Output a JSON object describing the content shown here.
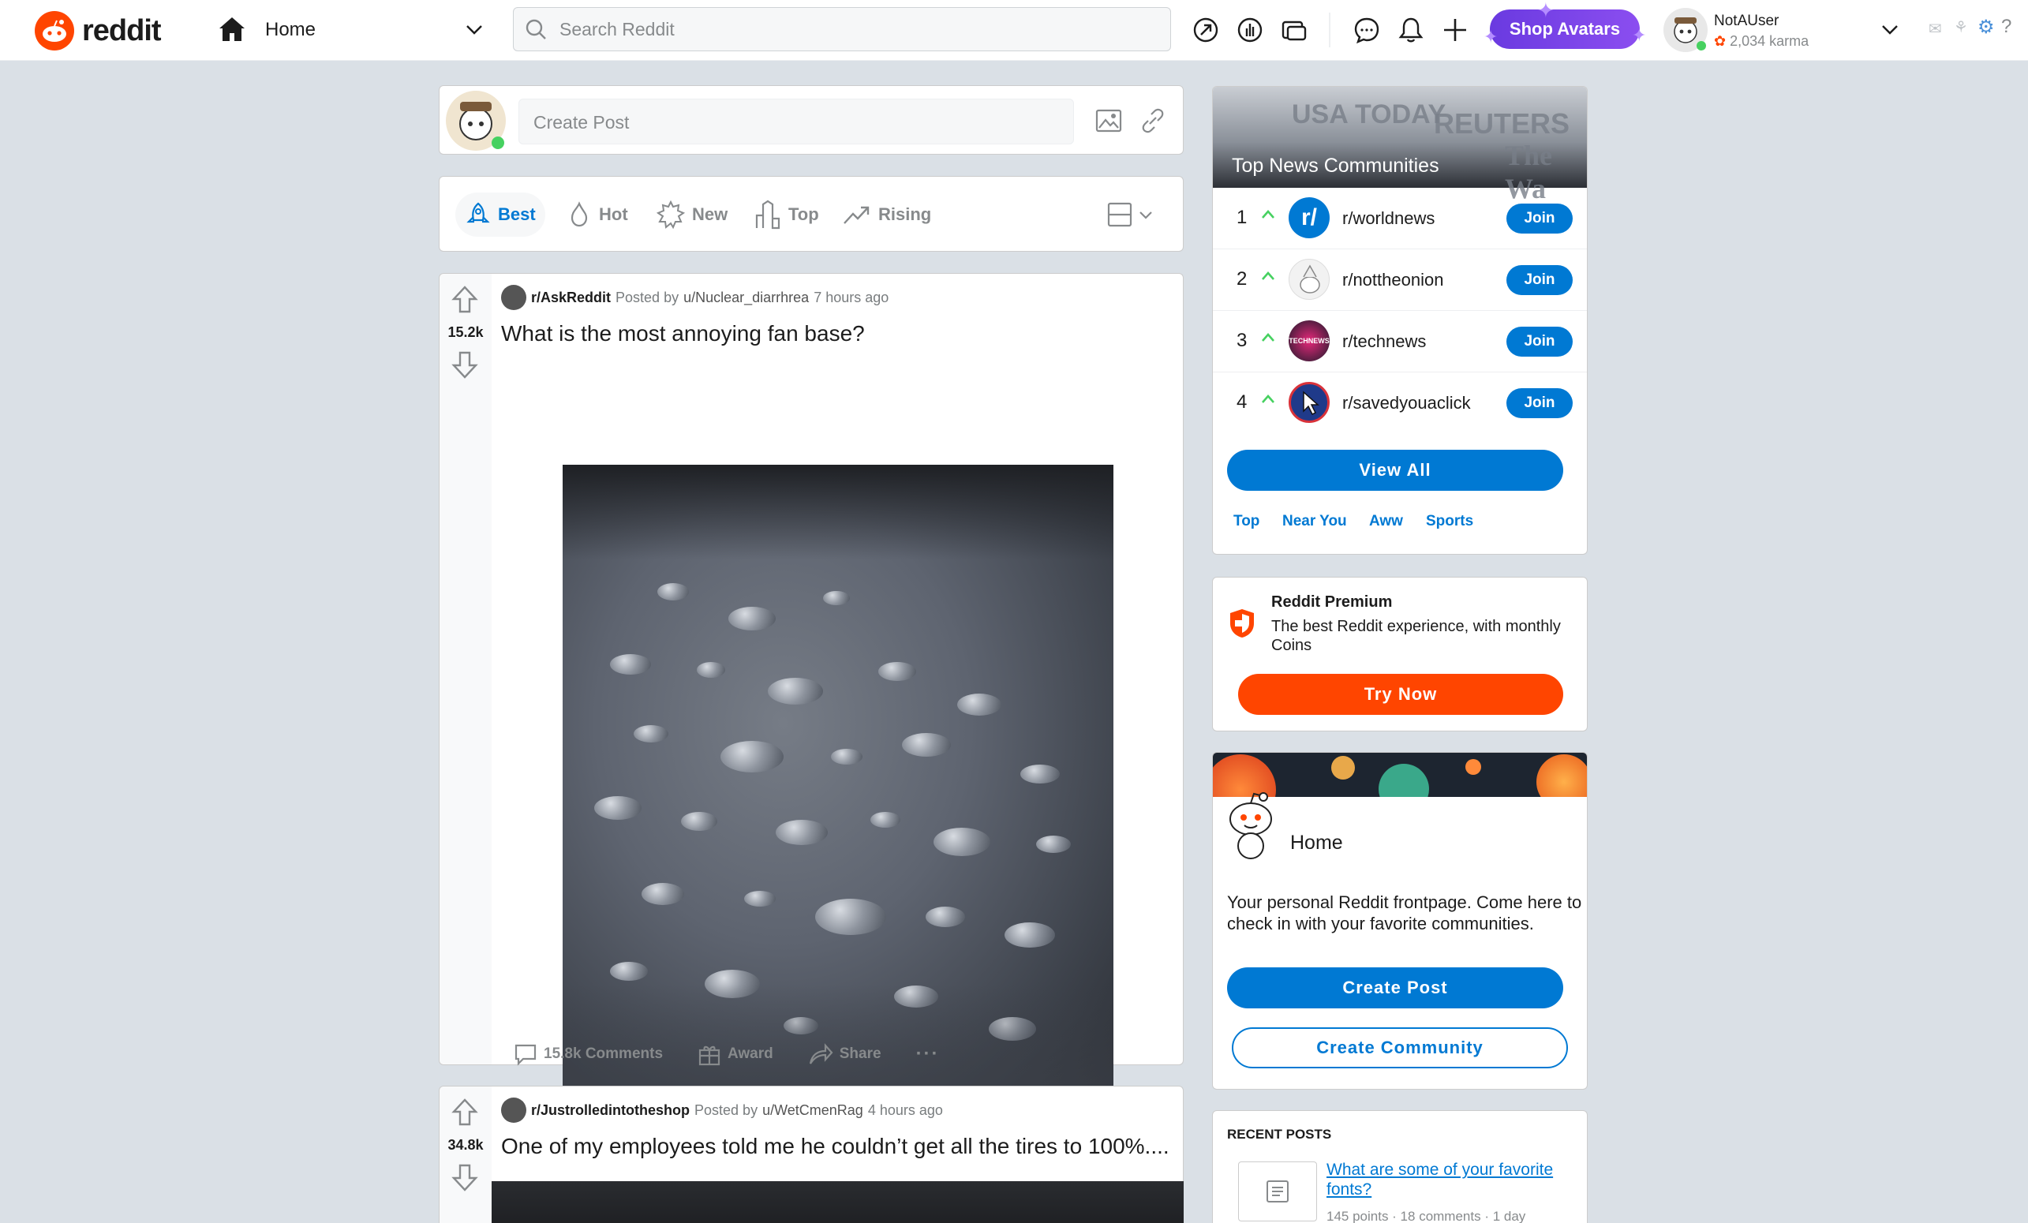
{
  "header": {
    "logo_text": "reddit",
    "home_label": "Home",
    "search_placeholder": "Search Reddit",
    "shop_label": "Shop Avatars",
    "username": "NotAUser",
    "karma": "2,034 karma"
  },
  "create_post": {
    "placeholder": "Create Post"
  },
  "sort": {
    "best": "Best",
    "hot": "Hot",
    "new": "New",
    "top": "Top",
    "rising": "Rising"
  },
  "posts": [
    {
      "score": "15.2k",
      "subreddit": "r/AskReddit",
      "posted_by": "Posted by",
      "author": "u/Nuclear_diarrhrea",
      "time": "7 hours ago",
      "title": "What is the most annoying fan base?",
      "comments": "15.8k Comments",
      "award": "Award",
      "share": "Share",
      "more": "···"
    },
    {
      "score": "34.8k",
      "subreddit": "r/Justrolledintotheshop",
      "posted_by": "Posted by",
      "author": "u/WetCmenRag",
      "time": "4 hours ago",
      "title": "One of my employees told me he couldn’t get all the tires to 100%...."
    }
  ],
  "news": {
    "title": "Top News Communities",
    "watermark_1": "USA TODAY",
    "watermark_2": "REUTERS",
    "watermark_3": "The Wa",
    "communities": [
      {
        "rank": "1",
        "name": "r/worldnews",
        "join": "Join",
        "color": "#0079d3"
      },
      {
        "rank": "2",
        "name": "r/nottheonion",
        "join": "Join",
        "color": "#e8e8e8"
      },
      {
        "rank": "3",
        "name": "r/technews",
        "join": "Join",
        "color": "#d8266f",
        "avatar_text": "TECHNEWS"
      },
      {
        "rank": "4",
        "name": "r/savedyouaclick",
        "join": "Join",
        "color": "#1f3a8a"
      }
    ],
    "view_all": "View All",
    "tags": [
      "Top",
      "Near You",
      "Aww",
      "Sports"
    ]
  },
  "premium": {
    "title": "Reddit Premium",
    "desc": "The best Reddit experience, with monthly Coins",
    "button": "Try Now"
  },
  "home_card": {
    "title": "Home",
    "desc": "Your personal Reddit frontpage. Come here to check in with your favorite communities.",
    "create_post": "Create Post",
    "create_community": "Create Community"
  },
  "recent": {
    "title": "RECENT POSTS",
    "link": "What are some of your favorite fonts?",
    "meta": "145 points · 18 comments · 1 day"
  },
  "colors": {
    "accent": "#0079d3",
    "orange": "#ff4500",
    "upvote_green": "#46d160"
  }
}
